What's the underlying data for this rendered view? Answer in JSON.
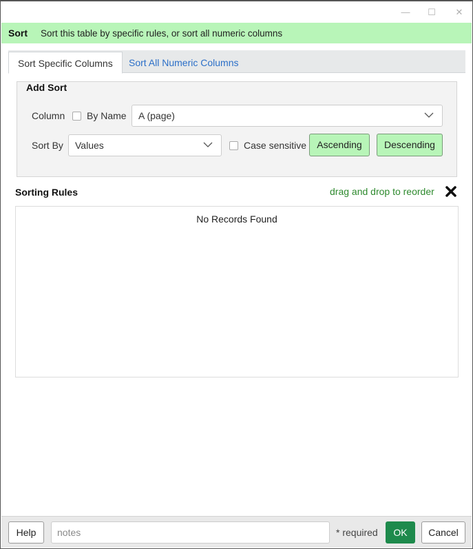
{
  "window": {
    "controls": {
      "minimize": "—",
      "maximize": "☐",
      "close": "✕"
    }
  },
  "banner": {
    "title": "Sort",
    "description": "Sort this table by specific rules, or sort all numeric columns",
    "color": "#b8f5b8"
  },
  "tabs": [
    {
      "label": "Sort Specific Columns",
      "active": true
    },
    {
      "label": "Sort All Numeric Columns",
      "active": false
    }
  ],
  "add_sort": {
    "legend": "Add Sort",
    "column_label": "Column",
    "by_name_label": "By Name",
    "by_name_checked": false,
    "column_value": "A (page)",
    "sort_by_label": "Sort By",
    "sort_by_value": "Values",
    "case_sensitive_label": "Case sensitive",
    "case_sensitive_checked": false,
    "ascending_label": "Ascending",
    "descending_label": "Descending"
  },
  "rules": {
    "title": "Sorting Rules",
    "reorder_hint": "drag and drop to reorder",
    "empty_text": "No Records Found",
    "clear_icon": "x-icon"
  },
  "footer": {
    "help_label": "Help",
    "notes_placeholder": "notes",
    "required_text": "* required",
    "ok_label": "OK",
    "cancel_label": "Cancel",
    "ok_color": "#1e8a4c"
  }
}
